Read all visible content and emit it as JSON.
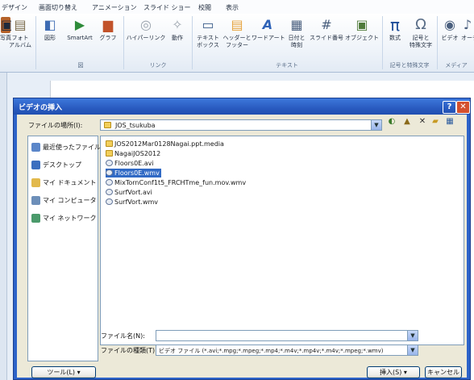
{
  "ribbon": {
    "tabs": [
      "デザイン",
      "画面切り替え",
      "アニメーション",
      "スライド ショー",
      "校閲",
      "表示"
    ],
    "buttons": [
      {
        "label": "写真",
        "sub": "",
        "icon": "picture-icon",
        "color": "#b5622a"
      },
      {
        "label": "フォト",
        "sub": "アルバム",
        "icon": "photo-album-icon",
        "color": "#7a6a4a"
      },
      {
        "label": "図形",
        "sub": "",
        "icon": "shapes-icon",
        "color": "#3d6bb3"
      },
      {
        "label": "SmartArt",
        "sub": "",
        "icon": "smartart-icon",
        "color": "#2e8b3a"
      },
      {
        "label": "グラフ",
        "sub": "",
        "icon": "chart-icon",
        "color": "#c2532b"
      },
      {
        "label": "ハイパーリンク",
        "sub": "",
        "icon": "hyperlink-icon",
        "color": "#9aa3ad"
      },
      {
        "label": "動作",
        "sub": "",
        "icon": "action-icon",
        "color": "#9aa3ad"
      },
      {
        "label": "テキスト",
        "sub": "ボックス",
        "icon": "textbox-icon",
        "color": "#3c5d8a"
      },
      {
        "label": "ヘッダーと",
        "sub": "フッター",
        "icon": "header-footer-icon",
        "color": "#e6a23c"
      },
      {
        "label": "ワードアート",
        "sub": "",
        "icon": "wordart-icon",
        "color": "#2f63b8"
      },
      {
        "label": "日付と",
        "sub": "時刻",
        "icon": "date-time-icon",
        "color": "#4a5f7e"
      },
      {
        "label": "スライド番号",
        "sub": "",
        "icon": "slide-number-icon",
        "color": "#4a5f7e"
      },
      {
        "label": "オブジェクト",
        "sub": "",
        "icon": "object-icon",
        "color": "#4f7a3a"
      },
      {
        "label": "数式",
        "sub": "",
        "icon": "equation-icon",
        "color": "#1f4e9a"
      },
      {
        "label": "記号と",
        "sub": "特殊文字",
        "icon": "symbol-icon",
        "color": "#5a6e88"
      },
      {
        "label": "ビデオ",
        "sub": "",
        "icon": "video-icon",
        "color": "#4a5f7e"
      },
      {
        "label": "オーディオ",
        "sub": "",
        "icon": "audio-icon",
        "color": "#4a5f7e"
      }
    ],
    "groups": [
      "図",
      "リンク",
      "テキスト",
      "記号と特殊文字",
      "メディア"
    ]
  },
  "dialog": {
    "title": "ビデオの挿入",
    "help_btn": "?",
    "close_btn": "✕",
    "lookin_label": "ファイルの場所(I):",
    "lookin_value": "JOS_tsukuba",
    "places": [
      {
        "label": "最近使ったファイル",
        "icon": "recent-icon"
      },
      {
        "label": "デスクトップ",
        "icon": "desktop-icon"
      },
      {
        "label": "マイ ドキュメント",
        "icon": "documents-icon"
      },
      {
        "label": "マイ コンピュータ",
        "icon": "computer-icon"
      },
      {
        "label": "マイ ネットワーク",
        "icon": "network-icon"
      }
    ],
    "files": [
      {
        "name": "JOS2012Mar0128Nagai.ppt.media",
        "type": "folder"
      },
      {
        "name": "NagaiJOS2012",
        "type": "folder"
      },
      {
        "name": "Floors0E.avi",
        "type": "media"
      },
      {
        "name": "Floors0E.wmv",
        "type": "media",
        "selected": true
      },
      {
        "name": "MixTornConf1t5_FRCHTme_fun.mov.wmv",
        "type": "media"
      },
      {
        "name": "SurfVort.avi",
        "type": "media"
      },
      {
        "name": "SurfVort.wmv",
        "type": "media"
      }
    ],
    "filename_label": "ファイル名(N):",
    "filename_value": "",
    "filetype_label": "ファイルの種類(T):",
    "filetype_value": "ビデオ ファイル (*.avi;*.mpg;*.mpeg;*.mp4;*.m4v;*.mp4v;*.m4v;*.mpeg;*.wmv)",
    "tools_btn": "ツール(L)",
    "insert_btn": "挿入(S)",
    "cancel_btn": "キャンセル"
  }
}
